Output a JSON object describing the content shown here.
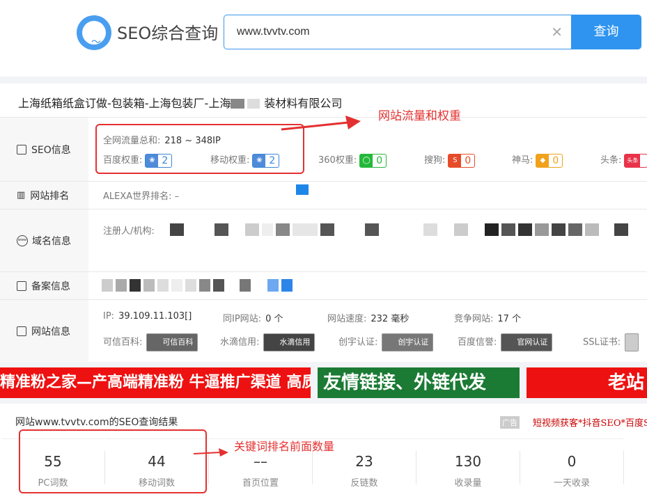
{
  "header": {
    "brand": "SEO综合查询",
    "search_value": "www.tvvtv.com",
    "search_button": "查询",
    "clear_icon": "close-icon"
  },
  "site_title": "上海纸箱纸盒订做-包装箱-上海包装厂-上海",
  "site_title_tail": "装材料有限公司",
  "annotations": {
    "traffic": "网站流量和权重",
    "keywords": "关键词排名前面数量"
  },
  "rows": {
    "seo": {
      "label": "SEO信息",
      "traffic_label": "全网流量总和:",
      "traffic_value": "218 ~ 348IP",
      "baidu_label": "百度权重:",
      "baidu_value": "2",
      "mobile_label": "移动权重:",
      "mobile_value": "2",
      "s360_label": "360权重:",
      "s360_value": "0",
      "sogou_label": "搜狗:",
      "sogou_value": "0",
      "shenma_label": "神马:",
      "shenma_value": "0",
      "toutiao_label": "头条:",
      "toutiao_icon_text": "头条"
    },
    "rank": {
      "label": "网站排名",
      "alexa": "ALEXA世界排名: –"
    },
    "domain": {
      "label": "域名信息",
      "registrant": "注册人/机构:"
    },
    "icp": {
      "label": "备案信息"
    },
    "site": {
      "label": "网站信息",
      "ip_label": "IP:",
      "ip_value": "39.109.11.103[]",
      "same_ip_label": "同IP网站:",
      "same_ip_value": "0 个",
      "speed_label": "网站速度:",
      "speed_value": "232 毫秒",
      "competitor_label": "竞争网站:",
      "competitor_value": "17 个",
      "kexin_label": "可信百科:",
      "kexin_cert": "可信百科",
      "shuidi_label": "水滴信用:",
      "shuidi_cert": "水滴信用",
      "chuangyu_label": "创宇认证:",
      "chuangyu_cert": "创宇认证",
      "baidu_xinyu_label": "百度信誉:",
      "baidu_cert": "官网认证",
      "ssl_label": "SSL证书:"
    }
  },
  "ads": {
    "ad1": "精准粉之家—产高端精准粉 牛逼推广渠道 高质量精准粉",
    "ad2": "友情链接、外链代发",
    "ad3": "老站"
  },
  "results": {
    "heading": "网站www.tvvtv.com的SEO查询结果",
    "ad_tag": "广告",
    "ad_text": "短视频获客*抖音SEO*百度SE",
    "stats": [
      {
        "value": "55",
        "label": "PC词数"
      },
      {
        "value": "44",
        "label": "移动词数"
      },
      {
        "value": "––",
        "label": "首页位置"
      },
      {
        "value": "23",
        "label": "反链数"
      },
      {
        "value": "130",
        "label": "收录量"
      },
      {
        "value": "0",
        "label": "一天收录"
      }
    ]
  }
}
